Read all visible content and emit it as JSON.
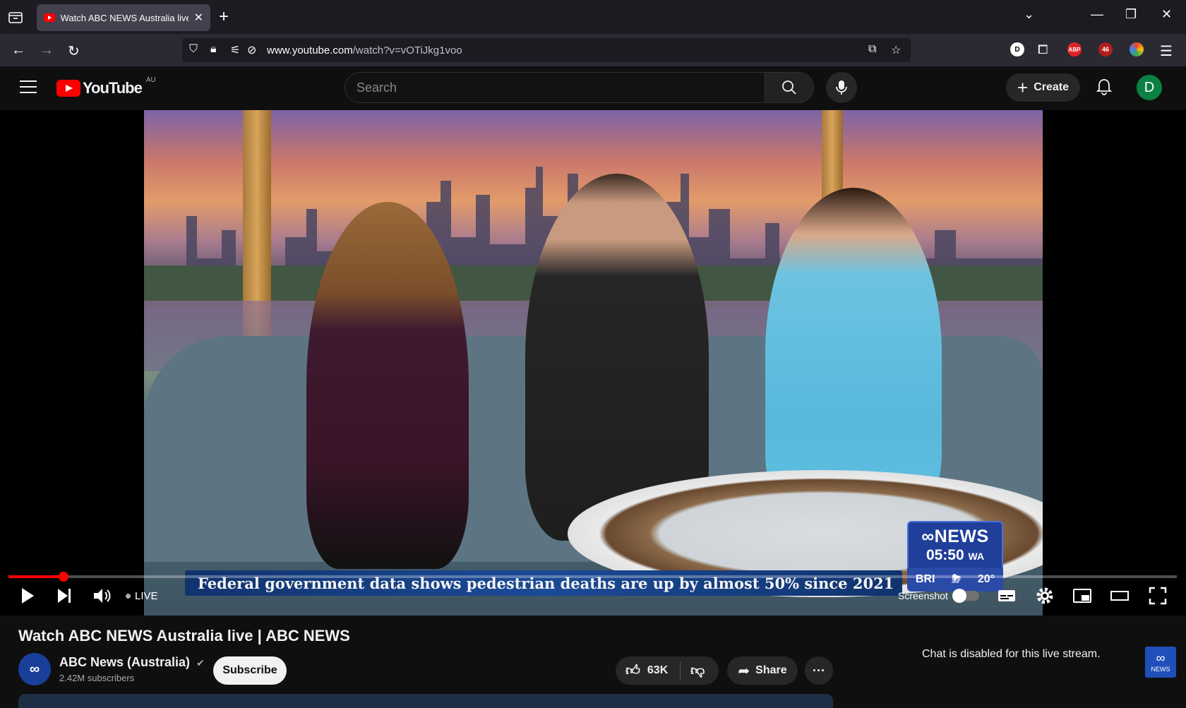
{
  "browser": {
    "tab_title": "Watch ABC NEWS Australia live | ABC NEWS",
    "tab_title_display": "Watch ABC NEWS Australia live |",
    "url_domain": "www.youtube.com",
    "url_path": "/watch?v=vOTiJkg1voo",
    "extension_badge": "46",
    "ext_abp": "ABP",
    "ext_d": "D"
  },
  "header": {
    "logo_word": "YouTube",
    "country": "AU",
    "search_placeholder": "Search",
    "create_label": "Create",
    "avatar_letter": "D"
  },
  "video": {
    "overlay_brand": "NEWS",
    "overlay_time": "05:50",
    "overlay_zone": "WA",
    "weather_city": "BRI",
    "weather_temp": "20°",
    "ticker": "Federal government data shows pedestrian deaths are up by almost 50% since 2021",
    "corner_logo": "NEWS",
    "progress": 0.047
  },
  "controls": {
    "live_label": "LIVE",
    "screenshot_label": "Screenshot"
  },
  "meta": {
    "title": "Watch ABC NEWS Australia live | ABC NEWS",
    "channel_name": "ABC News (Australia)",
    "subscribers": "2.42M subscribers",
    "subscribe_label": "Subscribe",
    "likes": "63K",
    "share_label": "Share",
    "chat_message": "Chat is disabled for this live stream."
  },
  "colors": {
    "accent": "#ff0000",
    "abc_blue": "#1f3f9a"
  }
}
